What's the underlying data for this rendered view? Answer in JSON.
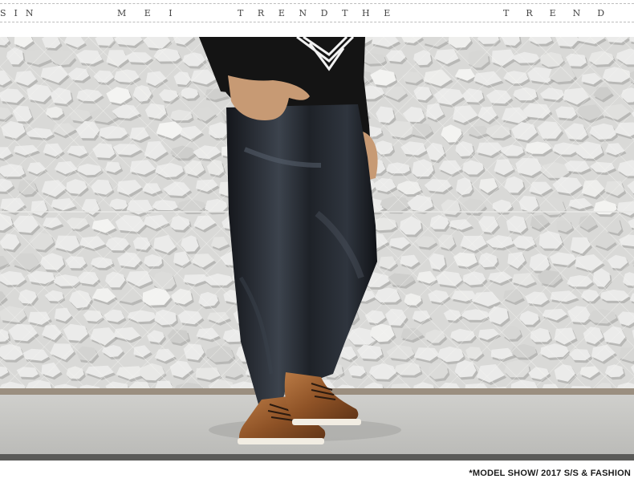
{
  "banner": {
    "segments": [
      "SIN",
      "MEI",
      "TRENDTHE",
      "TREND"
    ]
  },
  "photo": {
    "subject": "model-lower-body",
    "colors": {
      "wall": "#d9d9d7",
      "stone_light": "#ebebea",
      "stone_shadow": "#9c9c9a",
      "jeans": "#1c1f25",
      "jeans_highlight": "#5b6470",
      "boots": "#9a5a2c",
      "sole": "#f2ede3",
      "shirt": "#141414",
      "skin": "#c79a74",
      "floor": "#c2c2bf"
    }
  },
  "caption": {
    "text": "*MODEL SHOW/  2017 S/S & FASHION"
  }
}
